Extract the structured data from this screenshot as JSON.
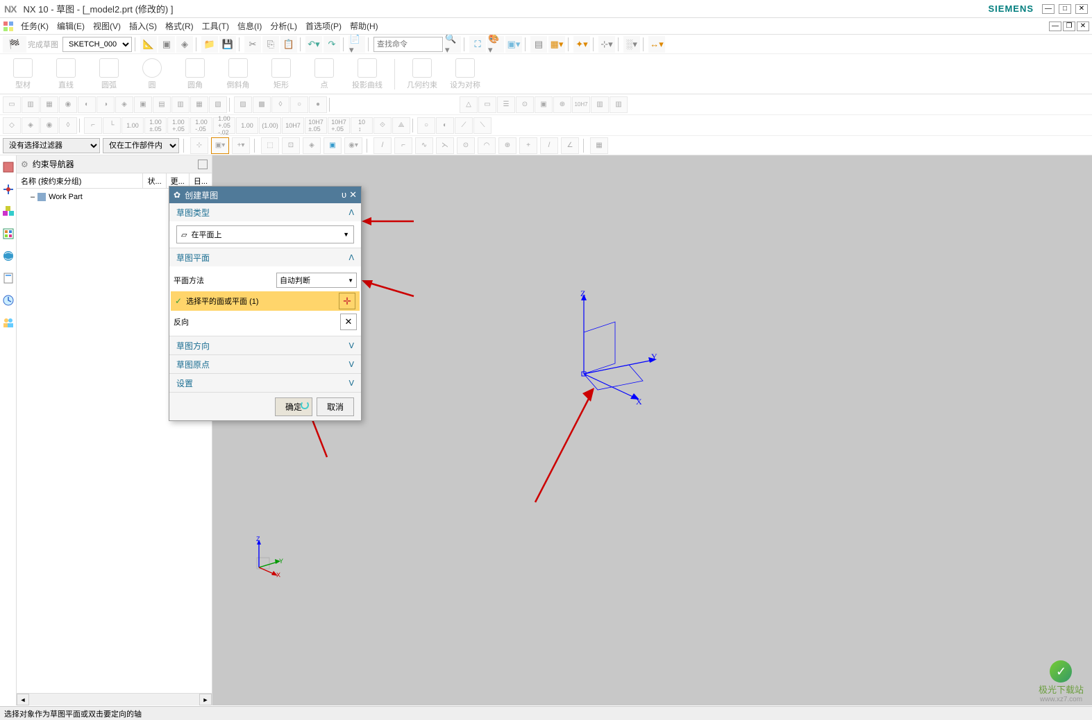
{
  "window": {
    "app": "NX",
    "title": "NX 10 - 草图 - [_model2.prt  (修改的)  ]",
    "brand": "SIEMENS"
  },
  "menu": {
    "items": [
      "任务(K)",
      "编辑(E)",
      "视图(V)",
      "插入(S)",
      "格式(R)",
      "工具(T)",
      "信息(I)",
      "分析(L)",
      "首选项(P)",
      "帮助(H)"
    ]
  },
  "toolbar1": {
    "finish_sketch": "完成草图",
    "sketch_name": "SKETCH_000",
    "search_placeholder": "查找命令"
  },
  "ribbon": {
    "items": [
      "型材",
      "直线",
      "圆弧",
      "圆",
      "圆角",
      "倒斜角",
      "矩形",
      "点",
      "投影曲线",
      "几何约束",
      "设为对称"
    ]
  },
  "filter_row": {
    "filter1": "没有选择过滤器",
    "filter2": "仅在工作部件内"
  },
  "navigator": {
    "title": "约束导航器",
    "col_name": "名称 (按约束分组)",
    "col_state": "状...",
    "col_other": "更...",
    "col_other2": "日...",
    "root": "Work Part"
  },
  "dialog": {
    "title": "创建草图",
    "section_type": "草图类型",
    "type_value": "在平面上",
    "section_plane": "草图平面",
    "plane_method_label": "平面方法",
    "plane_method_value": "自动判断",
    "select_plane": "选择平的面或平面 (1)",
    "reverse": "反向",
    "section_orient": "草图方向",
    "section_origin": "草图原点",
    "section_settings": "设置",
    "ok": "确定",
    "cancel": "取消"
  },
  "axes": {
    "x": "X",
    "y": "Y",
    "z": "Z"
  },
  "status": "选择对象作为草图平面或双击要定向的轴",
  "watermark": {
    "text": "极光下载站",
    "url": "www.xz7.com"
  }
}
